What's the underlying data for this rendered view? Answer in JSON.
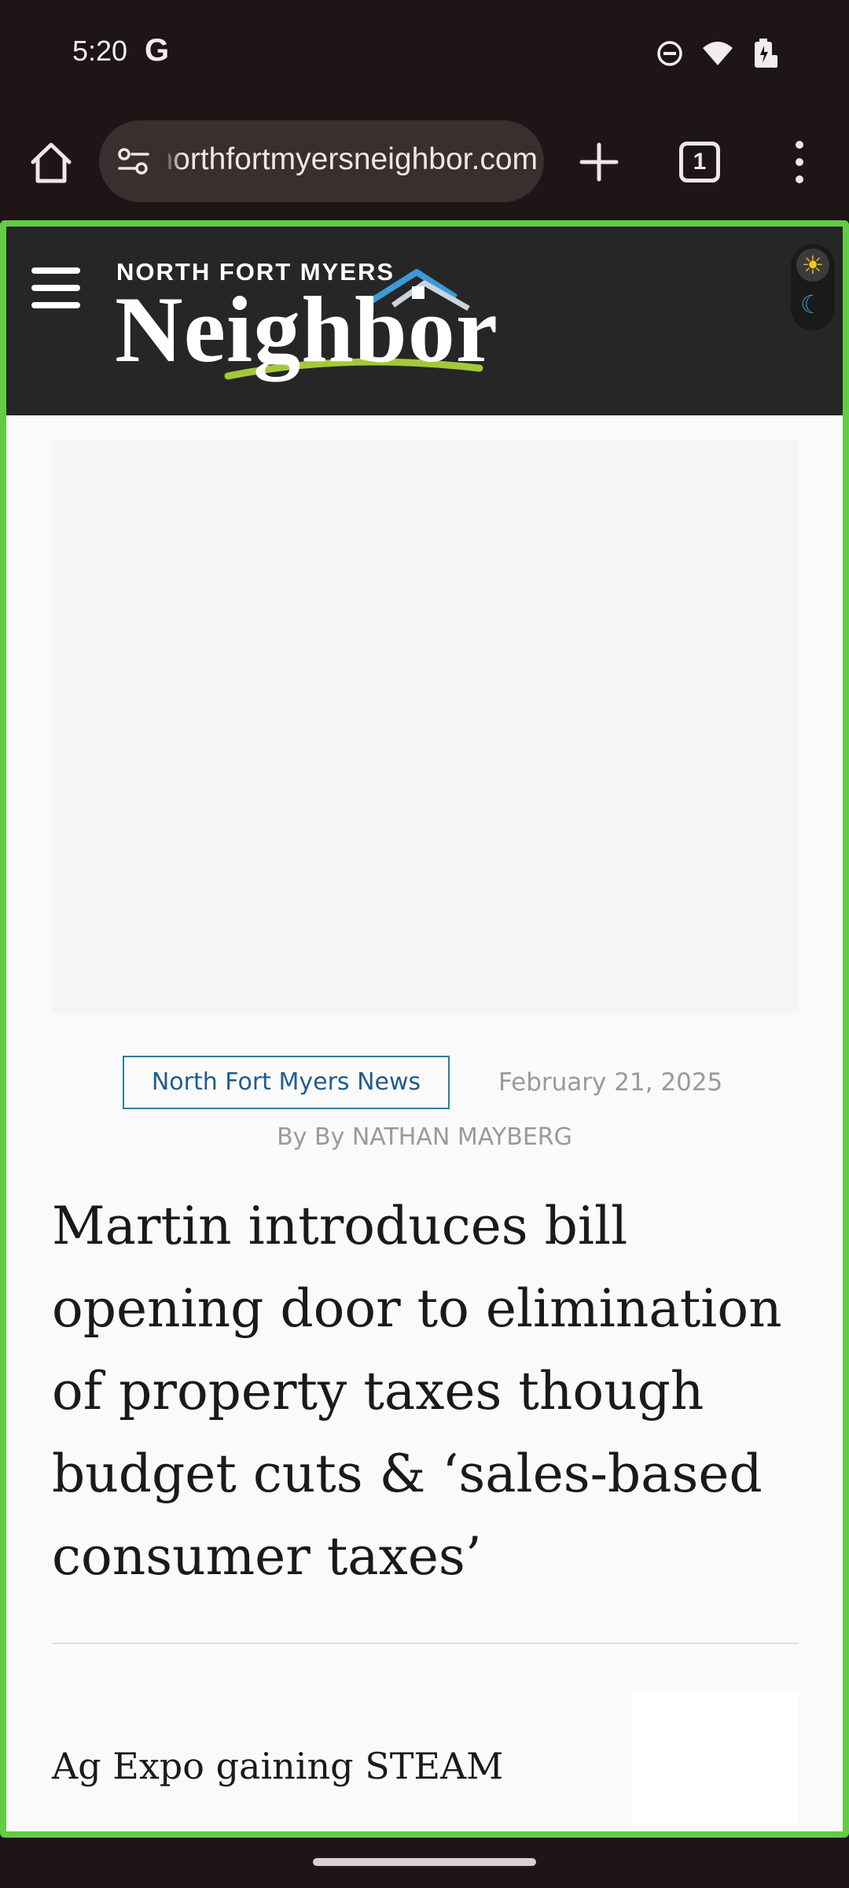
{
  "status_bar": {
    "time": "5:20",
    "google_glyph": "G",
    "icons": [
      "do-not-disturb-icon",
      "wifi-icon",
      "battery-charging-icon"
    ]
  },
  "browser": {
    "url": "northfortmyersneighbor.com",
    "tab_count": "1",
    "accent_color": "#62cc44"
  },
  "site": {
    "logo_top": "NORTH FORT MYERS",
    "logo_main": "Neighbor"
  },
  "article": {
    "category": "North Fort Myers News",
    "date": "February 21, 2025",
    "byline": "By By NATHAN MAYBERG",
    "headline": "Martin introduces bill opening door to elimination of property taxes though budget cuts & ‘sales-based consumer taxes’"
  },
  "related": {
    "title": "Ag Expo gaining STEAM"
  }
}
